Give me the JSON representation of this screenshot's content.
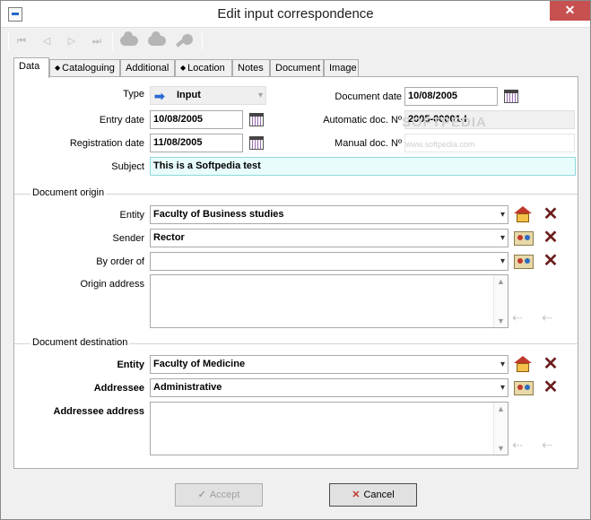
{
  "window": {
    "title": "Edit input correspondence",
    "close_glyph": "✕",
    "icon": "input-document-icon"
  },
  "toolbar": {
    "buttons": [
      {
        "name": "first-record-icon",
        "glyph": "⏮"
      },
      {
        "name": "previous-record-icon",
        "glyph": "◁"
      },
      {
        "name": "next-record-icon",
        "glyph": "▷"
      },
      {
        "name": "last-record-icon",
        "glyph": "⏭"
      }
    ]
  },
  "tabs": [
    {
      "label": "Data",
      "dot": false,
      "active": true
    },
    {
      "label": "Cataloguing",
      "dot": true
    },
    {
      "label": "Additional",
      "dot": false
    },
    {
      "label": "Location",
      "dot": true
    },
    {
      "label": "Notes",
      "dot": false
    },
    {
      "label": "Document",
      "dot": false
    },
    {
      "label": "Image",
      "dot": false
    }
  ],
  "dot_glyph": "◆",
  "data_tab": {
    "type_label": "Type",
    "type_value": "Input",
    "document_date_label": "Document date",
    "document_date": "10/08/2005",
    "entry_date_label": "Entry date",
    "entry_date": "10/08/2005",
    "automatic_doc_label": "Automatic doc. Nº",
    "automatic_doc": "2005-00001-I",
    "registration_date_label": "Registration date",
    "registration_date": "11/08/2005",
    "manual_doc_label": "Manual doc. Nº",
    "manual_doc": "",
    "subject_label": "Subject",
    "subject": "This is a Softpedia test"
  },
  "origin": {
    "group_title": "Document origin",
    "entity_label": "Entity",
    "entity": "Faculty of Business studies",
    "sender_label": "Sender",
    "sender": "Rector",
    "by_order_label": "By order of",
    "by_order": "",
    "address_label": "Origin address",
    "address": ""
  },
  "destination": {
    "group_title": "Document destination",
    "entity_label": "Entity",
    "entity": "Faculty of Medicine",
    "addressee_label": "Addressee",
    "addressee": "Administrative",
    "address_label": "Addressee address",
    "address": ""
  },
  "footer": {
    "accept_label": "Accept",
    "cancel_label": "Cancel"
  },
  "watermark": "SOFTPEDIA",
  "watermark_small": "www.softpedia.com",
  "glyphs": {
    "dropdown": "▾",
    "scroll_up": "▲",
    "scroll_down": "▼",
    "arrow_left": "⇠",
    "x": "✕",
    "check": "✓",
    "type_arrow": "➡"
  }
}
